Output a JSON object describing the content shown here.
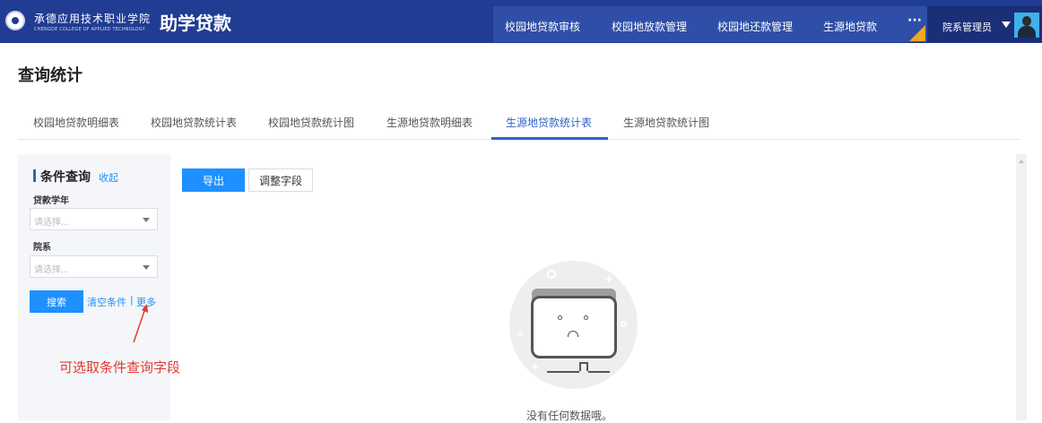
{
  "header": {
    "college_name_cn": "承德应用技术职业学院",
    "college_name_en": "CHENGDE COLLEGE OF APPLIED TECHNOLOGY",
    "app_title": "助学贷款",
    "nav_items": [
      "校园地贷款审核",
      "校园地放款管理",
      "校园地还款管理",
      "生源地贷款"
    ],
    "more_label": "···",
    "user_role": "院系管理员",
    "icons": [
      "college-logo-icon",
      "more-icon",
      "caret-down-icon",
      "avatar"
    ]
  },
  "page": {
    "title": "查询统计"
  },
  "tabs": {
    "items": [
      "校园地贷款明细表",
      "校园地贷款统计表",
      "校园地贷款统计图",
      "生源地贷款明细表",
      "生源地贷款统计表",
      "生源地贷款统计图"
    ],
    "active": "生源地贷款统计表"
  },
  "filter": {
    "title": "条件查询",
    "collapse_label": "收起",
    "fields": [
      {
        "label": "贷款学年",
        "placeholder": "请选择..."
      },
      {
        "label": "院系",
        "placeholder": "请选择..."
      }
    ],
    "search_label": "搜索",
    "clear_label": "清空条件",
    "separator": "|",
    "more_label": "更多"
  },
  "toolbar": {
    "export_label": "导出",
    "adjust_fields_label": "调整字段"
  },
  "annotation": {
    "text": "可选取条件查询字段"
  },
  "empty_state": {
    "message": "没有任何数据哦。",
    "icon": "empty-folder-icon"
  },
  "colors": {
    "header_bg": "#203c93",
    "accent": "#1e90ff",
    "tab_active": "#2f63c8",
    "annotation": "#e53935"
  }
}
